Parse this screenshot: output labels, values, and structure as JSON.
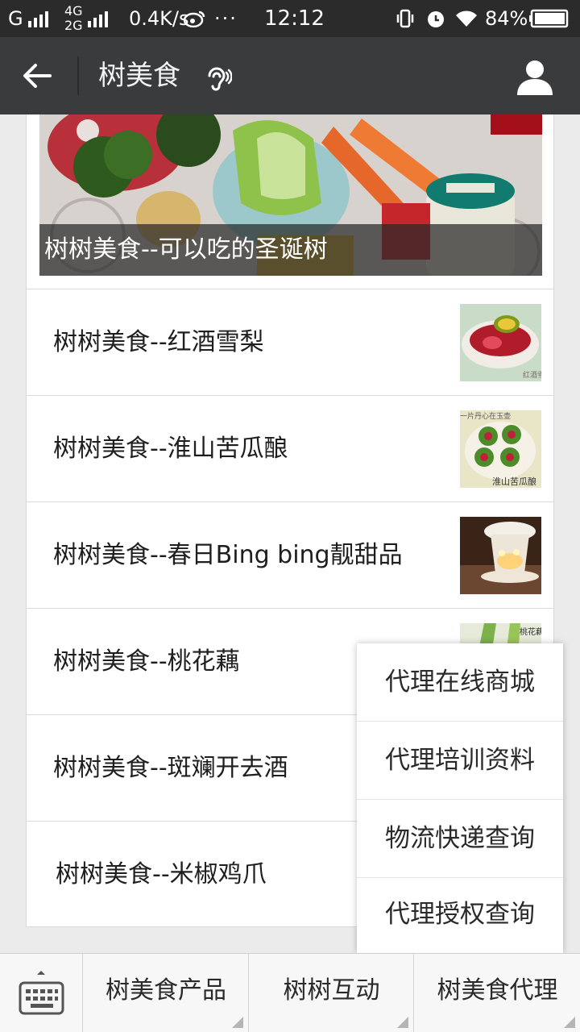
{
  "status_bar": {
    "carrier_left": "G",
    "net_top": "4G",
    "net_bottom": "2G",
    "speed": "0.4K/s",
    "weibo_icon": "weibo-icon",
    "overflow": "···",
    "time": "12:12",
    "battery": "84%"
  },
  "header": {
    "back_icon": "back-arrow-icon",
    "title": "树美食",
    "ear_icon": "ear-icon",
    "user_icon": "person-icon"
  },
  "articles": {
    "cover_title": "树树美食--可以吃的圣诞树",
    "items": [
      {
        "title": "树树美食--红酒雪梨",
        "thumb_text": "红酒雪"
      },
      {
        "title": "树树美食--淮山苦瓜酿",
        "thumb_top": "一片丹心在玉壶",
        "thumb_text": "淮山苦瓜酿"
      },
      {
        "title": "树树美食--春日Bing bing靓甜品"
      },
      {
        "title": "树树美食--桃花藕",
        "thumb_text": "桃花藕"
      },
      {
        "title": "树树美食--斑斓开去酒"
      },
      {
        "title": "树树美食--米椒鸡爪"
      }
    ]
  },
  "popup_menu": {
    "items": [
      "代理在线商城",
      "代理培训资料",
      "物流快递查询",
      "代理授权查询"
    ]
  },
  "bottom_menu": {
    "keyboard_icon": "keyboard-icon",
    "tabs": [
      "树美食产品",
      "树树互动",
      "树美食代理"
    ]
  },
  "colors": {
    "status_bar": "#2b2b2b",
    "title_bar": "#3a3b3d",
    "page_bg": "#ebebeb"
  }
}
